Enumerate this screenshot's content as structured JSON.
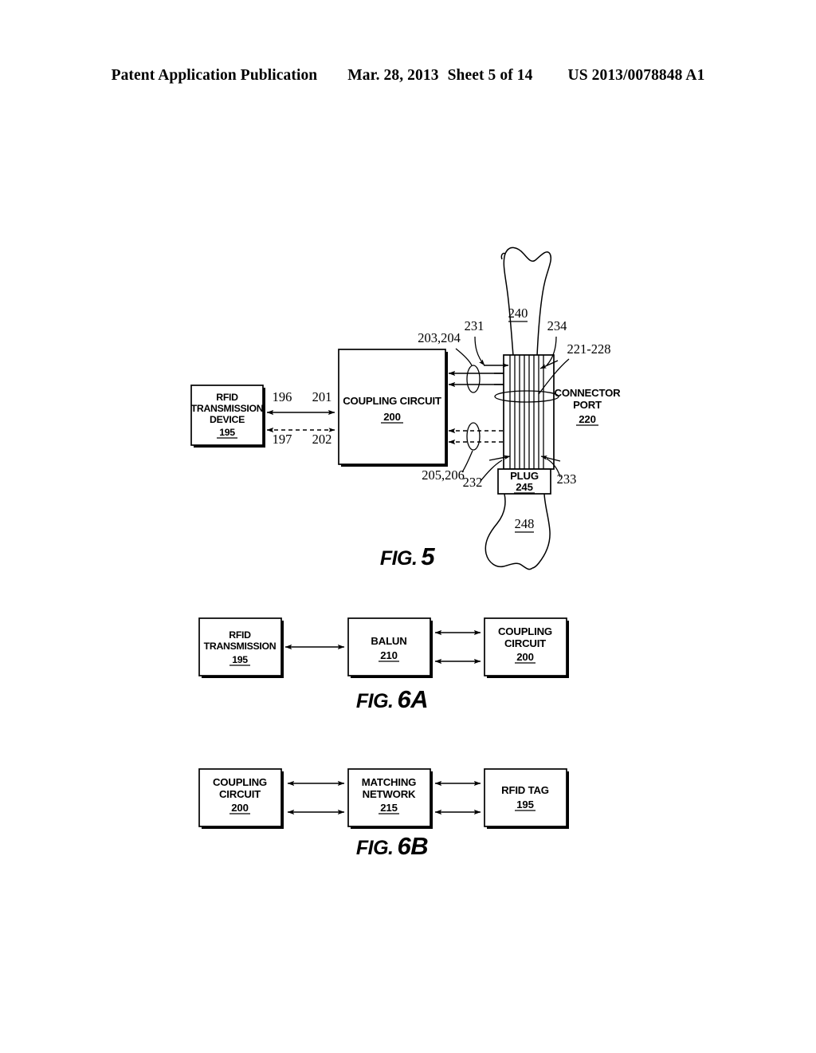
{
  "header": {
    "publication": "Patent Application Publication",
    "date": "Mar. 28, 2013",
    "sheet": "Sheet 5 of 14",
    "patent_number": "US 2013/0078848 A1"
  },
  "figures": [
    {
      "id": "fig5",
      "label_prefix": "FIG.",
      "label_number": "5",
      "blocks": {
        "rfid_device": {
          "line1": "RFID",
          "line2": "TRANSMISSION",
          "line3": "DEVICE",
          "ref": "195"
        },
        "coupling_circuit": {
          "line1": "COUPLING CIRCUIT",
          "ref": "200"
        },
        "connector_port": {
          "line1": "CONNECTOR",
          "line2": "PORT",
          "ref": "220"
        },
        "plug": {
          "line1": "PLUG",
          "ref": "245"
        }
      },
      "reference_numerals": {
        "signal_196": "196",
        "signal_197": "197",
        "signal_201": "201",
        "signal_202": "202",
        "signal_203_204": "203,204",
        "signal_205_206": "205,206",
        "pin_231": "231",
        "pin_232": "232",
        "pin_233": "233",
        "pin_234": "234",
        "pins_221_228": "221-228",
        "cable_240": "240",
        "cable_248": "248"
      }
    },
    {
      "id": "fig6a",
      "label_prefix": "FIG.",
      "label_number": "6A",
      "blocks": {
        "rfid_transmission": {
          "line1": "RFID",
          "line2": "TRANSMISSION",
          "ref": "195"
        },
        "balun": {
          "line1": "BALUN",
          "ref": "210"
        },
        "coupling_circuit": {
          "line1": "COUPLING",
          "line2": "CIRCUIT",
          "ref": "200"
        }
      }
    },
    {
      "id": "fig6b",
      "label_prefix": "FIG.",
      "label_number": "6B",
      "blocks": {
        "coupling_circuit": {
          "line1": "COUPLING",
          "line2": "CIRCUIT",
          "ref": "200"
        },
        "matching_network": {
          "line1": "MATCHING",
          "line2": "NETWORK",
          "ref": "215"
        },
        "rfid_tag": {
          "line1": "RFID TAG",
          "ref": "195"
        }
      }
    }
  ],
  "colors": {
    "ink": "#000000",
    "paper": "#ffffff"
  }
}
